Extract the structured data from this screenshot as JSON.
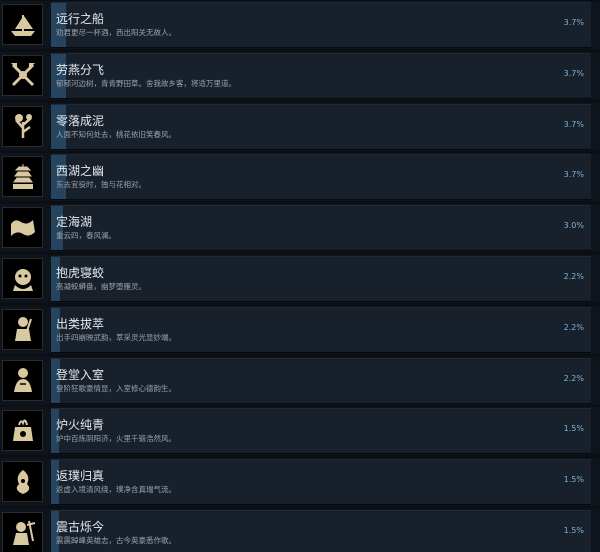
{
  "colors": {
    "background": "#0b0f14",
    "row_bar": "#17202b",
    "progress_fill": "#27445f",
    "title_text": "#e6e9ec",
    "desc_text": "#9aa3ad",
    "percent_text": "#7fb3d8",
    "icon_gold": "#d8c9a0"
  },
  "achievements": [
    {
      "icon": "boat-icon",
      "title": "远行之船",
      "desc": "劝君更尽一杯酒，西出阳关无故人。",
      "percent": "3.7%",
      "rate": 0.037
    },
    {
      "icon": "crossed-axes-icon",
      "title": "劳燕分飞",
      "desc": "郁郁河边树，青青野田草。舍我故乡客，将适万里道。",
      "percent": "3.7%",
      "rate": 0.037
    },
    {
      "icon": "withered-tree-icon",
      "title": "零落成泥",
      "desc": "人面不知何处去，桃花依旧笑春风。",
      "percent": "3.7%",
      "rate": 0.037
    },
    {
      "icon": "pagoda-icon",
      "title": "西湖之幽",
      "desc": "东去宜役时，独与花相对。",
      "percent": "3.7%",
      "rate": 0.037
    },
    {
      "icon": "scroll-icon",
      "title": "定海湖",
      "desc": "重云四，春风澜。",
      "percent": "3.0%",
      "rate": 0.03
    },
    {
      "icon": "tiger-icon",
      "title": "抱虎寝蛟",
      "desc": "亮凝蛟蟒盘，幽梦堕雁灵。",
      "percent": "2.2%",
      "rate": 0.022
    },
    {
      "icon": "warrior-icon",
      "title": "出类拔萃",
      "desc": "出手四崩映武韵，萃采灵光显妙端。",
      "percent": "2.2%",
      "rate": 0.022
    },
    {
      "icon": "sage-icon",
      "title": "登堂入室",
      "desc": "登阶狂歌豪情显，入室修心德韵生。",
      "percent": "2.2%",
      "rate": 0.022
    },
    {
      "icon": "furnace-icon",
      "title": "炉火纯青",
      "desc": "炉中百炼阴阳济，火里千锻浩然风。",
      "percent": "1.5%",
      "rate": 0.015
    },
    {
      "icon": "spirit-icon",
      "title": "返璞归真",
      "desc": "返虚入境清风绕，璞净含真瑞气流。",
      "percent": "1.5%",
      "rate": 0.015
    },
    {
      "icon": "ancient-warrior-icon",
      "title": "震古烁今",
      "desc": "震震踔峰英雄志，古今英豪悉作歌。",
      "percent": "1.5%",
      "rate": 0.015
    }
  ]
}
